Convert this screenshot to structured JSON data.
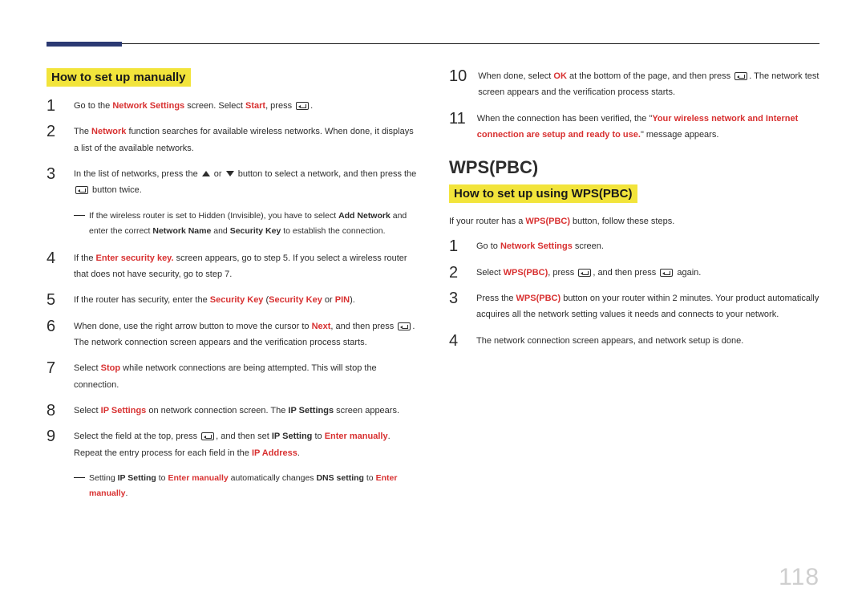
{
  "page_number": "118",
  "left": {
    "heading": "How to set up manually",
    "step1": {
      "num": "1",
      "pre": "Go to the ",
      "r1": "Network Settings",
      "mid": " screen. Select ",
      "r2": "Start",
      "post": ", press "
    },
    "step2": {
      "num": "2",
      "pre": "The ",
      "r1": "Network",
      "post": " function searches for available wireless networks. When done, it displays a list of the available networks."
    },
    "step3": {
      "num": "3",
      "pre": "In the list of networks, press the ",
      "mid": " or ",
      "mid2": " button to select a network, and then press the ",
      "post": " button twice."
    },
    "note1": {
      "pre": "If the wireless router is set to Hidden (Invisible), you have to select ",
      "b1": "Add Network",
      "mid": " and enter the correct ",
      "b2": "Network Name",
      "and": " and ",
      "b3": "Security Key",
      "post": " to establish the connection."
    },
    "step4": {
      "num": "4",
      "pre": "If the ",
      "r1": "Enter security key.",
      "post": " screen appears, go to step 5. If you select a wireless router that does not have security, go to step 7."
    },
    "step5": {
      "num": "5",
      "pre": "If the router has security, enter the ",
      "r1": "Security Key",
      "open": " (",
      "r2": "Security Key",
      "or": " or ",
      "r3": "PIN",
      "close": ")."
    },
    "step6": {
      "num": "6",
      "pre": "When done, use the right arrow button to move the cursor to ",
      "r1": "Next",
      "mid": ", and then press ",
      "post": ". The network connection screen appears and the verification process starts."
    },
    "step7": {
      "num": "7",
      "pre": "Select ",
      "r1": "Stop",
      "post": " while network connections are being attempted. This will stop the connection."
    },
    "step8": {
      "num": "8",
      "pre": "Select ",
      "r1": "IP Settings",
      "mid": " on network connection screen. The ",
      "b1": "IP Settings",
      "post": " screen appears."
    },
    "step9": {
      "num": "9",
      "pre": "Select the field at the top, press ",
      "mid": ", and then set ",
      "b1": "IP Setting",
      "to": " to ",
      "r1": "Enter manually",
      "post": ". Repeat the entry process for each field in the ",
      "r2": "IP Address",
      "dot": "."
    },
    "note2": {
      "pre": "Setting ",
      "b1": "IP Setting",
      "to": " to ",
      "r1": "Enter manually",
      "mid": " automatically changes ",
      "b2": "DNS setting",
      "to2": " to ",
      "r2": "Enter manually",
      "dot": "."
    }
  },
  "right": {
    "step10": {
      "num": "10",
      "pre": "When done, select ",
      "r1": "OK",
      "mid": " at the bottom of the page, and then press ",
      "post": ". The network test screen appears and the verification process starts."
    },
    "step11": {
      "num": "11",
      "pre": "When the connection has been verified, the \"",
      "r1": "Your wireless network and Internet connection are setup and ready to use.",
      "post": "\" message appears."
    },
    "wps_title": "WPS(PBC)",
    "heading": "How to set up using WPS(PBC)",
    "intro": {
      "pre": "If your router has a ",
      "r1": "WPS(PBC)",
      "post": " button, follow these steps."
    },
    "wstep1": {
      "num": "1",
      "pre": "Go to ",
      "r1": "Network Settings",
      "post": " screen."
    },
    "wstep2": {
      "num": "2",
      "pre": "Select ",
      "r1": "WPS(PBC)",
      "mid": ", press ",
      "mid2": ", and then press ",
      "post": " again."
    },
    "wstep3": {
      "num": "3",
      "pre": "Press the ",
      "r1": "WPS(PBC)",
      "post": " button on your router within 2 minutes. Your product automatically acquires all the network setting values it needs and connects to your network."
    },
    "wstep4": {
      "num": "4",
      "body": "The network connection screen appears, and network setup is done."
    }
  }
}
